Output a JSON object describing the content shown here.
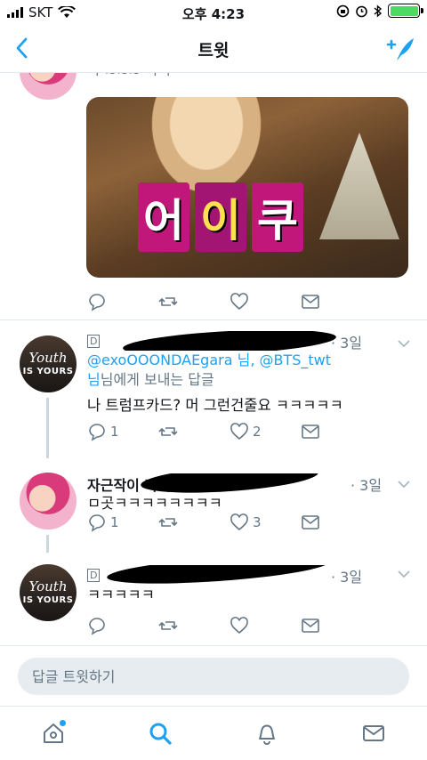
{
  "status": {
    "carrier": "SKT",
    "time": "오후 4:23"
  },
  "nav": {
    "title": "트윗"
  },
  "tweets": [
    {
      "header_partial": "ㅋ ~~~ ㅋㅋ",
      "media_text": [
        "어",
        "이",
        "쿠"
      ]
    },
    {
      "marker": "D",
      "time": "· 3일",
      "replying_handles": "@exoOOONDAEgara 님, @BTS_twt",
      "replying_suffix": "님에게 보내는 답글",
      "text": "나 트럼프카드? 머 그런건줄요 ㅋㅋㅋㅋㅋ",
      "replies": "1",
      "likes": "2",
      "avatar_line1": "Youth",
      "avatar_line2": "IS YOURS"
    },
    {
      "name": "자근작이 나비당",
      "time": "· 3일",
      "text": "ㅁ곳ㅋㅋㅋㅋㅋㅋㅋㅋ",
      "replies": "1",
      "likes": "3"
    },
    {
      "marker": "D",
      "time": "· 3일",
      "text": "ㅋㅋㅋㅋㅋ",
      "avatar_line1": "Youth",
      "avatar_line2": "IS YOURS"
    }
  ],
  "reply": {
    "placeholder": "답글 트윗하기"
  },
  "colors": {
    "accent": "#1da1f2",
    "muted": "#657786",
    "border": "#e1e8ed"
  },
  "tabs": [
    "home-icon",
    "search-icon",
    "notifications-icon",
    "messages-icon"
  ]
}
